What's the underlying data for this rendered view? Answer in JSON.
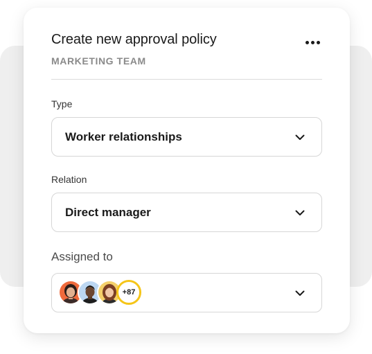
{
  "header": {
    "title": "Create new approval policy",
    "subtitle": "MARKETING TEAM",
    "more_icon": "more-horizontal-icon"
  },
  "fields": {
    "type": {
      "label": "Type",
      "value": "Worker relationships"
    },
    "relation": {
      "label": "Relation",
      "value": "Direct manager"
    },
    "assigned": {
      "label": "Assigned to",
      "extra_count": "+87"
    }
  },
  "colors": {
    "count_ring": "#f5c518",
    "backdrop": "#efefef",
    "border": "#d6d6d6"
  }
}
